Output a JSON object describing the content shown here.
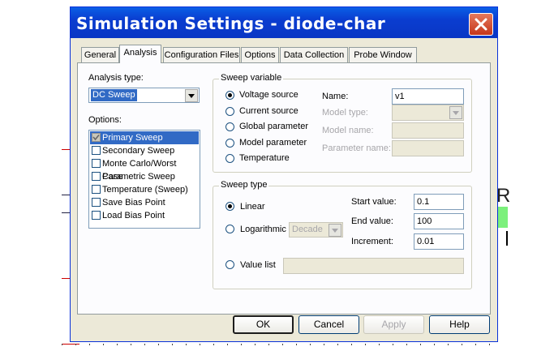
{
  "window": {
    "title": "Simulation Settings - diode-char"
  },
  "tabs": [
    "General",
    "Analysis",
    "Configuration Files",
    "Options",
    "Data Collection",
    "Probe Window"
  ],
  "analysis": {
    "type_label": "Analysis type:",
    "type_value": "DC Sweep",
    "options_label": "Options:",
    "options": [
      {
        "label": "Primary Sweep",
        "checked": true,
        "selected": true
      },
      {
        "label": "Secondary Sweep",
        "checked": false,
        "selected": false
      },
      {
        "label": "Monte Carlo/Worst Case",
        "checked": false,
        "selected": false
      },
      {
        "label": "Parametric Sweep",
        "checked": false,
        "selected": false
      },
      {
        "label": "Temperature (Sweep)",
        "checked": false,
        "selected": false
      },
      {
        "label": "Save Bias Point",
        "checked": false,
        "selected": false
      },
      {
        "label": "Load Bias Point",
        "checked": false,
        "selected": false
      }
    ]
  },
  "sweep_variable": {
    "legend": "Sweep variable",
    "radios": [
      "Voltage source",
      "Current source",
      "Global parameter",
      "Model parameter",
      "Temperature"
    ],
    "selected_index": 0,
    "name_label": "Name:",
    "name_value": "v1",
    "model_type_label": "Model type:",
    "model_name_label": "Model name:",
    "parameter_name_label": "Parameter name:"
  },
  "sweep_type": {
    "legend": "Sweep type",
    "linear_label": "Linear",
    "log_label": "Logarithmic",
    "log_scale": "Decade",
    "value_list_label": "Value list",
    "start_label": "Start value:",
    "start_value": "0.1",
    "end_label": "End value:",
    "end_value": "100",
    "increment_label": "Increment:",
    "increment_value": "0.01"
  },
  "buttons": {
    "ok": "OK",
    "cancel": "Cancel",
    "apply": "Apply",
    "help": "Help"
  },
  "background": {
    "glyph": "R"
  }
}
